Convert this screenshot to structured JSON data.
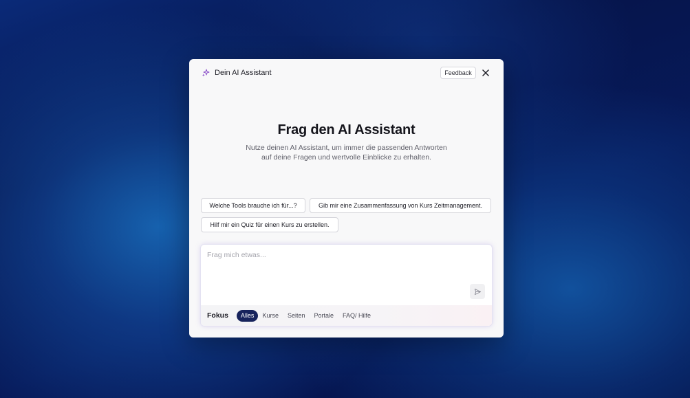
{
  "header": {
    "title": "Dein AI Assistant",
    "feedback_label": "Feedback",
    "icons": {
      "assistant": "sparkle-icon",
      "close": "close-icon"
    }
  },
  "hero": {
    "title": "Frag den AI Assistant",
    "subtitle_line1": "Nutze deinen AI Assistant, um immer die passenden Antworten",
    "subtitle_line2": "auf deine Fragen und wertvolle Einblicke zu erhalten."
  },
  "suggestions": [
    "Welche Tools brauche ich für...?",
    "Gib mir eine Zusammenfassung von Kurs Zeitmanagement.",
    "Hilf mir ein Quiz für einen Kurs zu erstellen."
  ],
  "composer": {
    "placeholder": "Frag mich etwas...",
    "value": "",
    "send_icon": "send-icon"
  },
  "focus": {
    "label": "Fokus",
    "filters": [
      "Alles",
      "Kurse",
      "Seiten",
      "Portale",
      "FAQ/ Hilfe"
    ],
    "active": "Alles"
  },
  "colors": {
    "accent": "#17235c",
    "sparkle": "#8a4fc8",
    "background_dark": "#06144a",
    "background_blue": "#1a6ebe"
  }
}
